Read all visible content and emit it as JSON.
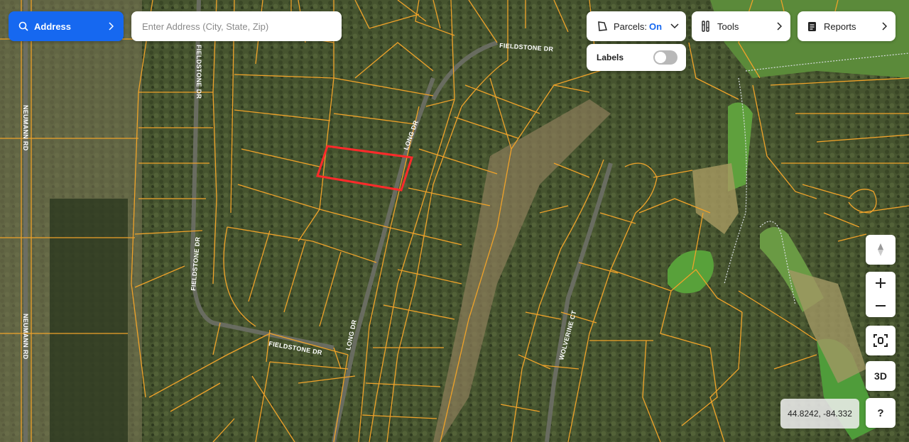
{
  "search": {
    "mode_label": "Address",
    "placeholder": "Enter Address (City, State, Zip)",
    "value": ""
  },
  "parcels": {
    "label": "Parcels:",
    "state": "On"
  },
  "labels_toggle": {
    "label": "Labels",
    "on": false
  },
  "tools": {
    "label": "Tools"
  },
  "reports": {
    "label": "Reports"
  },
  "controls": {
    "three_d": "3D",
    "help": "?"
  },
  "coords": "44.8242, -84.332",
  "roads": {
    "fieldstone_dr": "FIELDSTONE DR",
    "neumann_rd": "NEUMANN RD",
    "long_dr": "LONG DR",
    "wolverine_ct": "WOLVERINE CT"
  },
  "colors": {
    "accent": "#1668f0",
    "parcel_line": "#f0a229",
    "selected_parcel": "#ff2a2a"
  }
}
